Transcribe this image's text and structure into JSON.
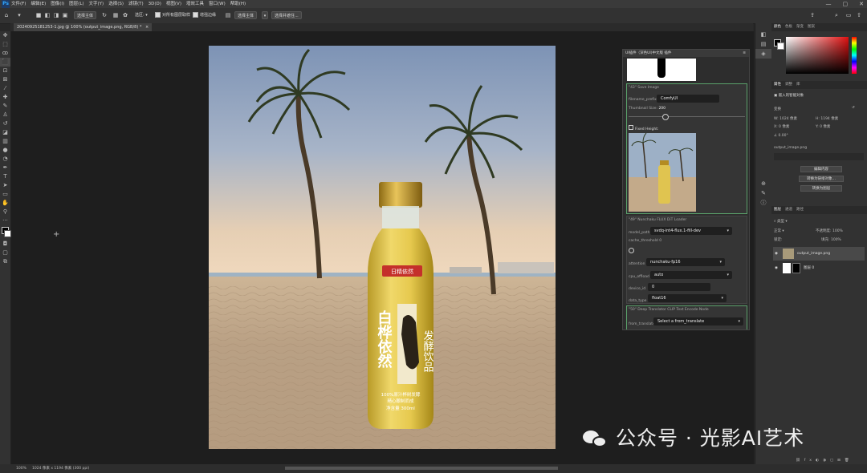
{
  "menubar": {
    "items": [
      "文件(F)",
      "编辑(E)",
      "图像(I)",
      "图层(L)",
      "文字(Y)",
      "选择(S)",
      "滤镜(T)",
      "3D(D)",
      "视图(V)",
      "增效工具",
      "窗口(W)",
      "帮助(H)"
    ],
    "win_minimize": "—",
    "win_restore": "▢",
    "win_close": "✕"
  },
  "optbar": {
    "select_subject": "选择主体",
    "mode_label": "选区:",
    "sample_all_layers": "对所有图层取样",
    "enhance_edge": "增强边缘",
    "select_and_mask": "选择并遮住...",
    "select_subject2": "选择主体"
  },
  "document": {
    "tab_title": "20240925181253-1.jpg @ 100% (output_image.png, RGB/8) *",
    "tab_close": "×"
  },
  "status": {
    "zoom": "100%",
    "size": "1024 像素 x 1194 像素 (300 ppi)"
  },
  "comfy": {
    "title": "UI插件（深色UI)中文版 插件",
    "save_node": {
      "title": "\"43\" Save Image",
      "filename_prefix_label": "filename_prefix",
      "filename_prefix_value": "ComfyUI",
      "thumb_size_label": "Thumbnail Size:",
      "thumb_size_value": "200",
      "fixed_height_label": "Fixed Height:"
    },
    "flux_node": {
      "title": "\"49\" Nunchaku FLUX DiT Loader",
      "model_path_label": "model_path",
      "model_path_value": "svdq-int4-flux.1-fill-dev",
      "cache_threshold_label": "cache_threshold 0",
      "attention_label": "attention",
      "attention_value": "nunchaku-fp16",
      "cpu_offload_label": "cpu_offload",
      "cpu_offload_value": "auto",
      "device_id_label": "device_id",
      "device_id_value": "0",
      "data_type_label": "data_type",
      "data_type_value": "float16"
    },
    "translate_node": {
      "title": "\"50\" Deep Translator CLIP Text Encode Node",
      "from_translate_label": "from_translate",
      "from_translate_value": "Select a from_translate"
    }
  },
  "right_panel": {
    "color_tabs": [
      "颜色",
      "色板",
      "渐变",
      "图案"
    ],
    "props_tabs": [
      "属性",
      "调整",
      "库"
    ],
    "props_title": "嵌入的智能对象",
    "transform_label": "变换",
    "w_label": "W:",
    "w_value": "1024 像素",
    "h_label": "H:",
    "h_value": "1194 像素",
    "x_label": "X:",
    "x_value": "0 像素",
    "y_label": "Y:",
    "y_value": "0 像素",
    "angle_value": "0.00°",
    "file_name": "output_image.png",
    "edit_contents": "编辑内容",
    "convert_linked": "转换为链接对象...",
    "convert_layers": "转换为图层",
    "layer_tabs": [
      "图层",
      "通道",
      "路径"
    ],
    "filter_kind": "类型",
    "blend_mode": "正常",
    "opacity_label": "不透明度:",
    "opacity_value": "100%",
    "lock_label": "锁定:",
    "fill_label": "填充:",
    "fill_value": "100%",
    "layers": [
      {
        "name": "output_image.png"
      },
      {
        "name": "图层 0"
      }
    ]
  },
  "bottle": {
    "brand": "日精依然",
    "title_vertical": "白桦依然",
    "side_text": "发酵饮品",
    "line1": "100%原汁桦树发酵",
    "line2": "精心酿制而成",
    "volume": "净含量 300ml"
  },
  "watermark": "公众号 · 光影AI艺术"
}
